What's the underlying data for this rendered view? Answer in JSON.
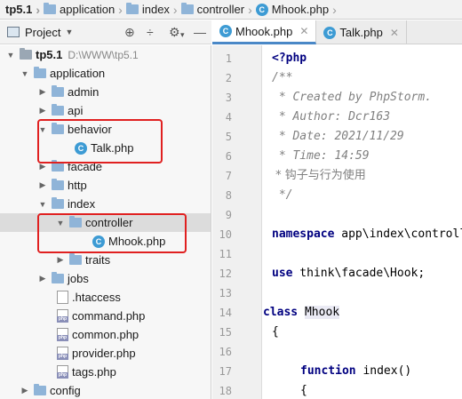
{
  "breadcrumb": {
    "items": [
      "tp5.1",
      "application",
      "index",
      "controller",
      "Mhook.php"
    ]
  },
  "project_panel": {
    "title": "Project",
    "tools": {
      "target": "⊕",
      "collapse": "÷",
      "settings": "⚙",
      "settings_drop": "▾",
      "hide": "—"
    }
  },
  "tree": {
    "root_name": "tp5.1",
    "root_path": "D:\\WWW\\tp5.1",
    "items": [
      {
        "label": "application"
      },
      {
        "label": "admin"
      },
      {
        "label": "api"
      },
      {
        "label": "behavior"
      },
      {
        "label": "Talk.php"
      },
      {
        "label": "facade"
      },
      {
        "label": "http"
      },
      {
        "label": "index"
      },
      {
        "label": "controller"
      },
      {
        "label": "Mhook.php"
      },
      {
        "label": "traits"
      },
      {
        "label": "jobs"
      },
      {
        "label": ".htaccess"
      },
      {
        "label": "command.php"
      },
      {
        "label": "common.php"
      },
      {
        "label": "provider.php"
      },
      {
        "label": "tags.php"
      },
      {
        "label": "config"
      }
    ]
  },
  "tabs": [
    {
      "label": "Mhook.php",
      "active": true
    },
    {
      "label": "Talk.php",
      "active": false
    }
  ],
  "editor": {
    "line_numbers": [
      "1",
      "2",
      "3",
      "4",
      "5",
      "6",
      "7",
      "8",
      "9",
      "10",
      "11",
      "12",
      "13",
      "14",
      "15",
      "16",
      "17",
      "18"
    ],
    "line1": "<?php",
    "line2": "/**",
    "line3": " * Created by PhpStorm.",
    "line4": " * Author: Dcr163",
    "line5": " * Date: 2021/11/29",
    "line6": " * Time: 14:59",
    "line7": " * 钩子与行为使用",
    "line8": " */",
    "line10_kw": "namespace",
    "line10_rest": " app\\index\\controll",
    "line12_kw": "use",
    "line12_rest": " think\\facade\\Hook;",
    "line14_kw": "class",
    "line14_name": "Mhook",
    "line15": "{",
    "line17_kw": "function",
    "line17_rest": " index()",
    "line18": "{"
  },
  "colors": {
    "highlight_box": "#e02020",
    "keyword": "#000080",
    "comment": "#808080",
    "active_tab_accent": "#4a88c7"
  }
}
